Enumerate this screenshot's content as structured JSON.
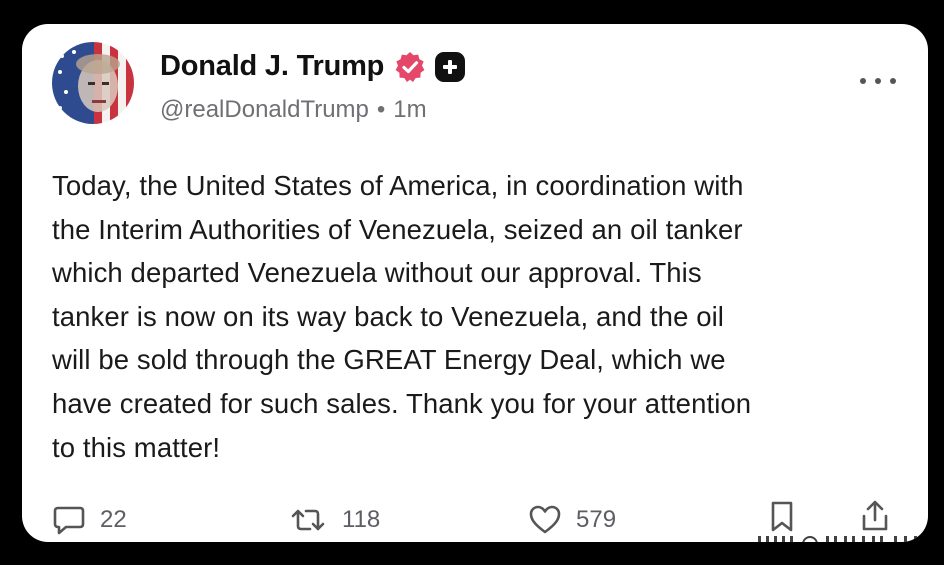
{
  "post": {
    "author": {
      "display_name": "Donald J. Trump",
      "handle": "@realDonaldTrump",
      "separator": "•",
      "time": "1m"
    },
    "text_lines": [
      "Today, the United States of America, in coordination with",
      "the Interim Authorities of Venezuela, seized an oil tanker",
      "which departed Venezuela without our approval. This",
      "tanker is now on its way back to Venezuela, and the oil",
      "will be sold through the GREAT Energy Deal, which we",
      "have created for such sales. Thank you for your attention",
      "to this matter!"
    ],
    "actions": {
      "replies": "22",
      "reposts": "118",
      "likes": "579"
    }
  },
  "icons": {
    "verified": "verified-badge-icon",
    "plus": "plus-badge-icon",
    "more": "more-options-icon",
    "reply": "reply-icon",
    "repost": "repost-icon",
    "like": "heart-icon",
    "bookmark": "bookmark-icon",
    "share": "share-icon"
  },
  "colors": {
    "verified_badge": "#e5476a",
    "plus_badge": "#111111",
    "background": "#000000",
    "card": "#ffffff",
    "secondary_text": "#6f6f74"
  }
}
